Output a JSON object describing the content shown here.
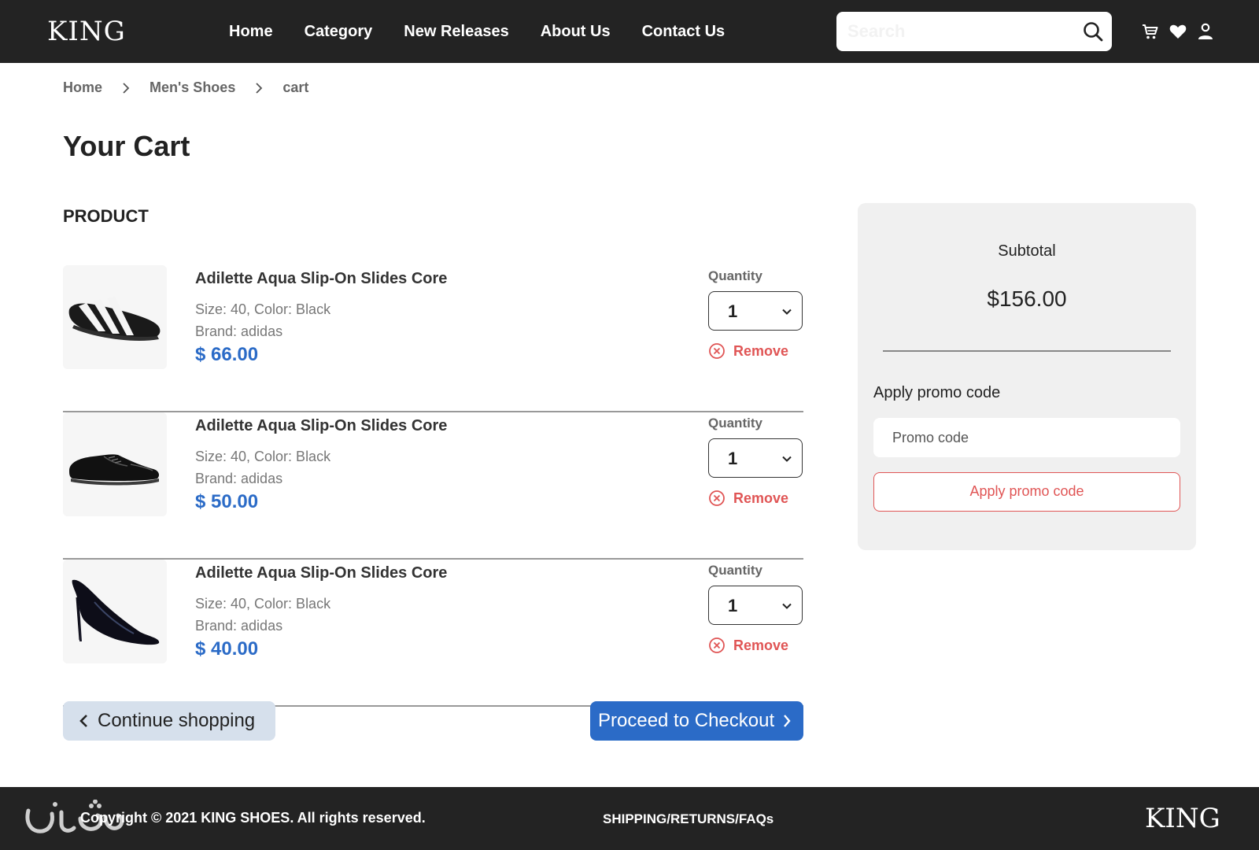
{
  "header": {
    "logo": "KING",
    "nav": [
      "Home",
      "Category",
      "New Releases",
      "About Us",
      "Contact Us"
    ],
    "search_placeholder": "Search",
    "icons": [
      "search-icon",
      "cart-icon",
      "heart-icon",
      "user-icon"
    ]
  },
  "breadcrumb": [
    "Home",
    "Men's Shoes",
    "cart"
  ],
  "page_title": "Your Cart",
  "product_header": "PRODUCT",
  "items": [
    {
      "name": "Adilette Aqua Slip-On Slides Core",
      "meta": "Size: 40,  Color: Black",
      "brand": "Brand: adidas",
      "price": "$ 66.00",
      "quantity_label": "Quantity",
      "quantity": "1",
      "remove_label": "Remove",
      "image": "slide-sandal"
    },
    {
      "name": "Adilette Aqua Slip-On Slides Core",
      "meta": "Size: 40,  Color: Black",
      "brand": "Brand: adidas",
      "price": "$ 50.00",
      "quantity_label": "Quantity",
      "quantity": "1",
      "remove_label": "Remove",
      "image": "oxford-shoe"
    },
    {
      "name": "Adilette Aqua Slip-On Slides Core",
      "meta": "Size: 40,  Color: Black",
      "brand": "Brand: adidas",
      "price": "$ 40.00",
      "quantity_label": "Quantity",
      "quantity": "1",
      "remove_label": "Remove",
      "image": "high-heel"
    }
  ],
  "buttons": {
    "continue": "Continue shopping",
    "checkout": "Proceed to Checkout"
  },
  "summary": {
    "subtotal_label": "Subtotal",
    "subtotal_value": "$156.00",
    "promo_label": "Apply promo code",
    "promo_placeholder": "Promo code",
    "promo_button": "Apply promo code"
  },
  "footer": {
    "copyright": "Copyright © 2021 KING SHOES. All rights reserved.",
    "links": "SHIPPING/RETURNS/FAQs",
    "logo": "KING"
  },
  "colors": {
    "header_bg": "#232323",
    "price_blue": "#2b6bc7",
    "remove_red": "#e05555",
    "panel_bg": "#f0f0f0",
    "continue_bg": "#d6e0ec"
  }
}
